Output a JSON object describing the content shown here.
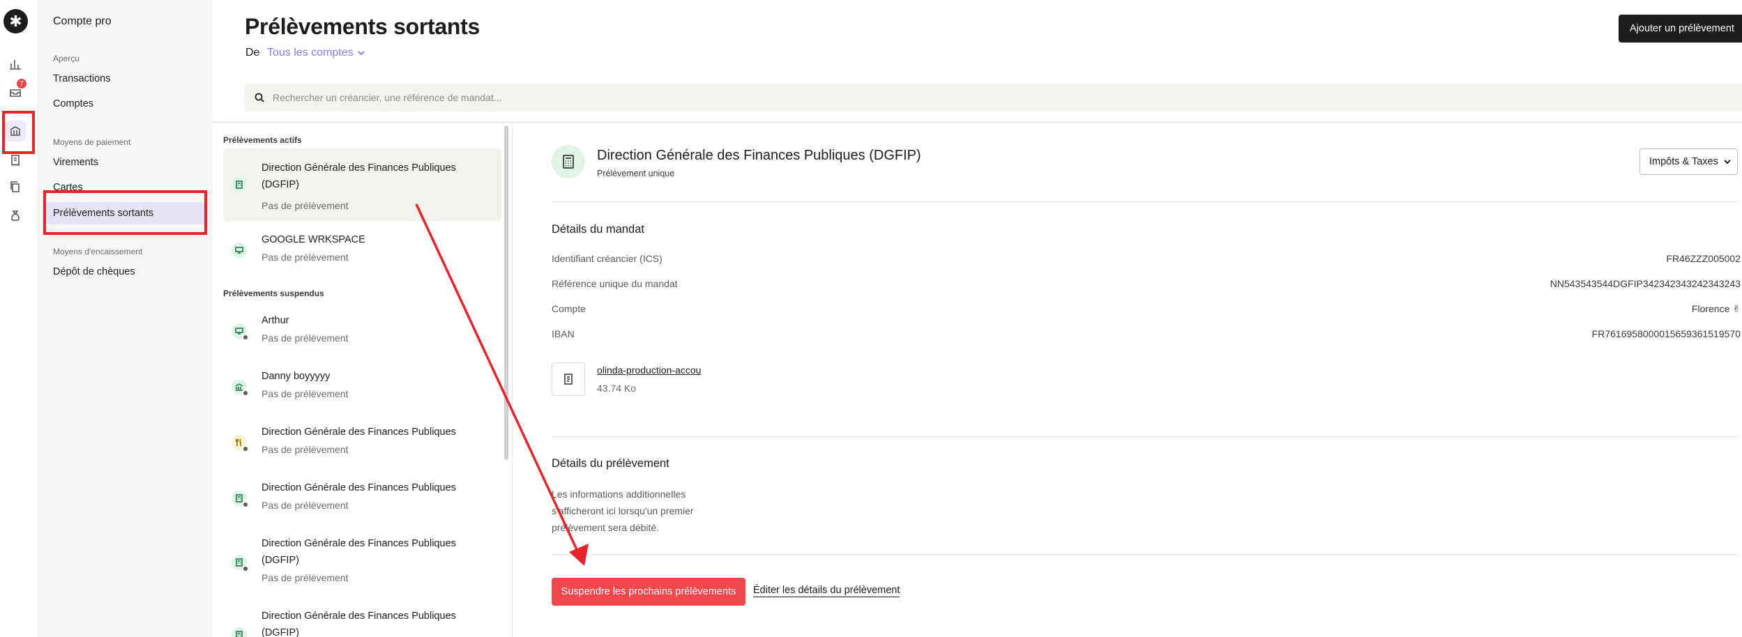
{
  "app": {
    "logo_glyph": "✱"
  },
  "rail": {
    "badge_count": "7",
    "icons": [
      "logo-icon",
      "bar-chart-icon",
      "inbox-icon",
      "bank-icon",
      "receipt-icon",
      "copy-icon",
      "money-bag-icon"
    ]
  },
  "nav": {
    "title": "Compte pro",
    "sections": [
      {
        "label": "Aperçu",
        "items": [
          "Transactions",
          "Comptes"
        ]
      },
      {
        "label": "Moyens de paiement",
        "items": [
          "Virements",
          "Cartes",
          "Prélèvements sortants"
        ]
      },
      {
        "label": "Moyens d'encaissement",
        "items": [
          "Dépôt de chèques"
        ]
      }
    ],
    "active_item": "Prélèvements sortants"
  },
  "header": {
    "title": "Prélèvements sortants",
    "de_label": "De",
    "accounts_filter": "Tous les comptes",
    "add_button": "Ajouter un prélèvement"
  },
  "search": {
    "placeholder": "Rechercher un créancier, une référence de mandat..."
  },
  "list": {
    "active_section": "Prélèvements actifs",
    "suspended_section": "Prélèvements suspendus",
    "active": [
      {
        "name": "Direction Générale des Finances Publiques (DGFIP)",
        "status": "Pas de prélèvement",
        "icon": "calculator-icon",
        "selected": true
      },
      {
        "name": "GOOGLE WRKSPACE",
        "status": "Pas de prélèvement",
        "icon": "monitor-icon"
      }
    ],
    "suspended": [
      {
        "name": "Arthur",
        "status": "Pas de prélèvement",
        "icon": "monitor-icon"
      },
      {
        "name": "Danny boyyyyy",
        "status": "Pas de prélèvement",
        "icon": "bank-icon"
      },
      {
        "name": "Direction Générale des Finances Publiques",
        "status": "Pas de prélèvement",
        "icon": "utensils-icon"
      },
      {
        "name": "Direction Générale des Finances Publiques",
        "status": "Pas de prélèvement",
        "icon": "calculator-icon"
      },
      {
        "name": "Direction Générale des Finances Publiques (DGFIP)",
        "status": "Pas de prélèvement",
        "icon": "calculator-icon"
      },
      {
        "name": "Direction Générale des Finances Publiques (DGFIP)",
        "status": "",
        "icon": "calculator-icon"
      }
    ]
  },
  "detail": {
    "title": "Direction Générale des Finances Publiques (DGFIP)",
    "subtitle": "Prélèvement unique",
    "category": "Impôts & Taxes",
    "mandate_section": "Détails du mandat",
    "fields": [
      {
        "label": "Identifiant créancier (ICS)",
        "value": "FR46ZZZ005002"
      },
      {
        "label": "Référence unique du mandat",
        "value": "NN543543544DGFIP342342343242343243"
      },
      {
        "label": "Compte",
        "value": "Florence ✌"
      },
      {
        "label": "IBAN",
        "value": "FR7616958000015659361519570"
      }
    ],
    "attachment": {
      "name": "olinda-production-accou",
      "size": "43.74 Ko"
    },
    "debit_section": "Détails du prélèvement",
    "debit_info": "Les informations additionnelles s'afficheront ici lorsqu'un premier prélèvement sera débité.",
    "suspend_button": "Suspendre les prochains prélèvements",
    "edit_link": "Éditer les détails du prélèvement"
  },
  "colors": {
    "accent": "#8b78e6",
    "danger": "#f1474d",
    "annotation": "#e8242a",
    "nav_active_bg": "#e6e3f7"
  }
}
